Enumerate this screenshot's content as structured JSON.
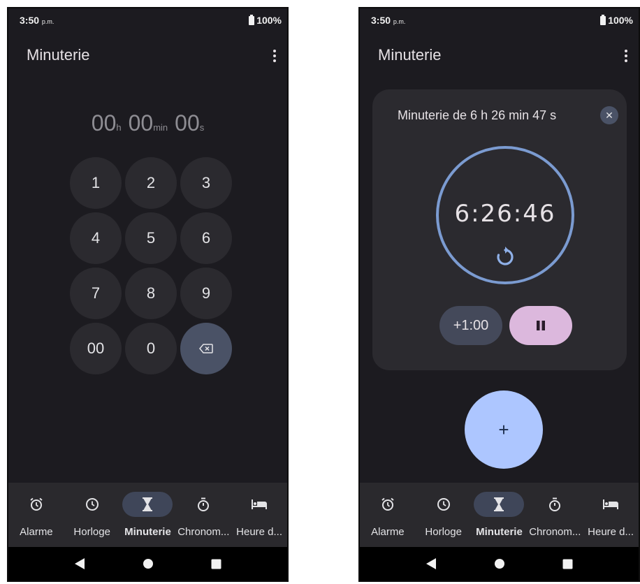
{
  "left_screen": {
    "status": {
      "time": "3:50",
      "time_suffix": "p.m.",
      "battery": "100%"
    },
    "appbar": {
      "title": "Minuterie"
    },
    "entry": {
      "hours": "00",
      "hours_unit": "h",
      "minutes": "00",
      "minutes_unit": "min",
      "seconds": "00",
      "seconds_unit": "s"
    },
    "keypad": [
      "1",
      "2",
      "3",
      "4",
      "5",
      "6",
      "7",
      "8",
      "9",
      "00",
      "0"
    ],
    "nav": [
      "Alarme",
      "Horloge",
      "Minuterie",
      "Chronom...",
      "Heure d..."
    ]
  },
  "right_screen": {
    "status": {
      "time": "3:50",
      "time_suffix": "p.m.",
      "battery": "100%"
    },
    "appbar": {
      "title": "Minuterie"
    },
    "card": {
      "title": "Minuterie de 6 h 26 min 47 s",
      "countdown": "6:26:46",
      "add_label": "+1:00",
      "remaining_fraction": 1.0
    },
    "fab_label": "+",
    "nav": [
      "Alarme",
      "Horloge",
      "Minuterie",
      "Chronom...",
      "Heure d..."
    ]
  },
  "icons": {
    "nav": [
      "alarm-icon",
      "clock-icon",
      "hourglass-icon",
      "stopwatch-icon",
      "bed-icon"
    ],
    "system": [
      "back-icon",
      "home-icon",
      "recents-icon"
    ]
  },
  "colors": {
    "background": "#1c1b20",
    "key": "#2b2a2f",
    "accent_blue": "#adc6ff",
    "ring": "#7b9bd1",
    "pause": "#dcb8dd",
    "nav_active": "#3f4659"
  }
}
